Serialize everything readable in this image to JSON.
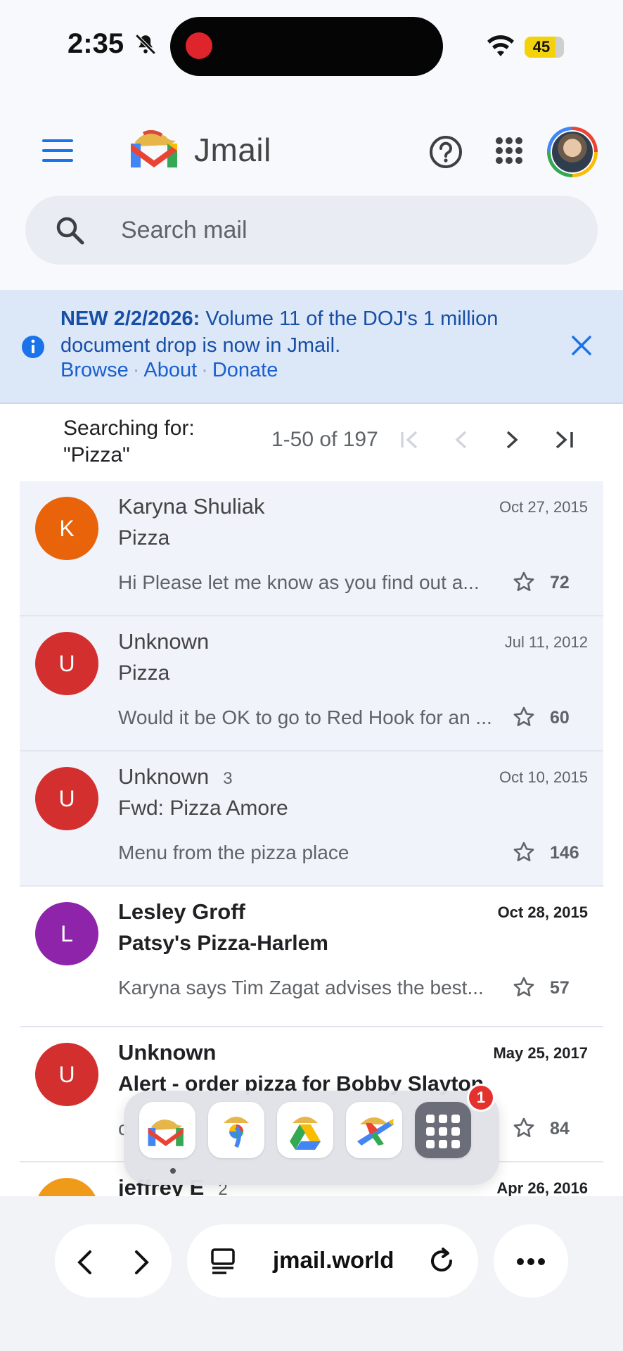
{
  "status": {
    "time": "2:35",
    "battery": "45"
  },
  "header": {
    "app_name": "Jmail"
  },
  "search": {
    "placeholder": "Search mail"
  },
  "banner": {
    "date_label": "NEW 2/2/2026:",
    "message": " Volume 11 of the DOJ's 1 million document drop is now in Jmail.",
    "links": [
      "Browse",
      "About",
      "Donate"
    ]
  },
  "results": {
    "label": "Searching for:",
    "query": "\"Pizza\"",
    "range": "1-50 of 197"
  },
  "emails": [
    {
      "initial": "K",
      "color": "#e8630a",
      "sender": "Karyna Shuliak",
      "count": "",
      "date": "Oct 27, 2015",
      "subject": "Pizza",
      "snippet": "Hi Please let me know as you find out a...",
      "number": "72",
      "read": true
    },
    {
      "initial": "U",
      "color": "#d32f2f",
      "sender": "Unknown",
      "count": "",
      "date": "Jul 11, 2012",
      "subject": "Pizza",
      "snippet": "Would it be OK to go to Red Hook for an ...",
      "number": "60",
      "read": true
    },
    {
      "initial": "U",
      "color": "#d32f2f",
      "sender": "Unknown",
      "count": "3",
      "date": "Oct 10, 2015",
      "subject": "Fwd: Pizza Amore",
      "snippet": "Menu from the pizza place",
      "number": "146",
      "read": true
    },
    {
      "initial": "L",
      "color": "#8e24aa",
      "sender": "Lesley Groff",
      "count": "",
      "date": "Oct 28, 2015",
      "subject": "Patsy's Pizza-Harlem",
      "snippet": "Karyna says Tim Zagat advises the best...",
      "number": "57",
      "read": false
    },
    {
      "initial": "U",
      "color": "#d32f2f",
      "sender": "Unknown",
      "count": "",
      "date": "May 25, 2017",
      "subject": "Alert - order pizza for Bobby Slayton",
      "snippet": "c",
      "number": "84",
      "read": false
    },
    {
      "initial": "",
      "color": "#f09a1a",
      "sender": "jeffrey E",
      "count": "2",
      "date": "Apr 26, 2016",
      "subject": "",
      "snippet": "",
      "number": "",
      "read": false
    }
  ],
  "dock": {
    "badge": "1",
    "apps": [
      "jmail-app-icon",
      "jphotos-app-icon",
      "jdrive-app-icon",
      "jflights-app-icon",
      "app-grid-icon"
    ]
  },
  "browser": {
    "url": "jmail.world"
  }
}
